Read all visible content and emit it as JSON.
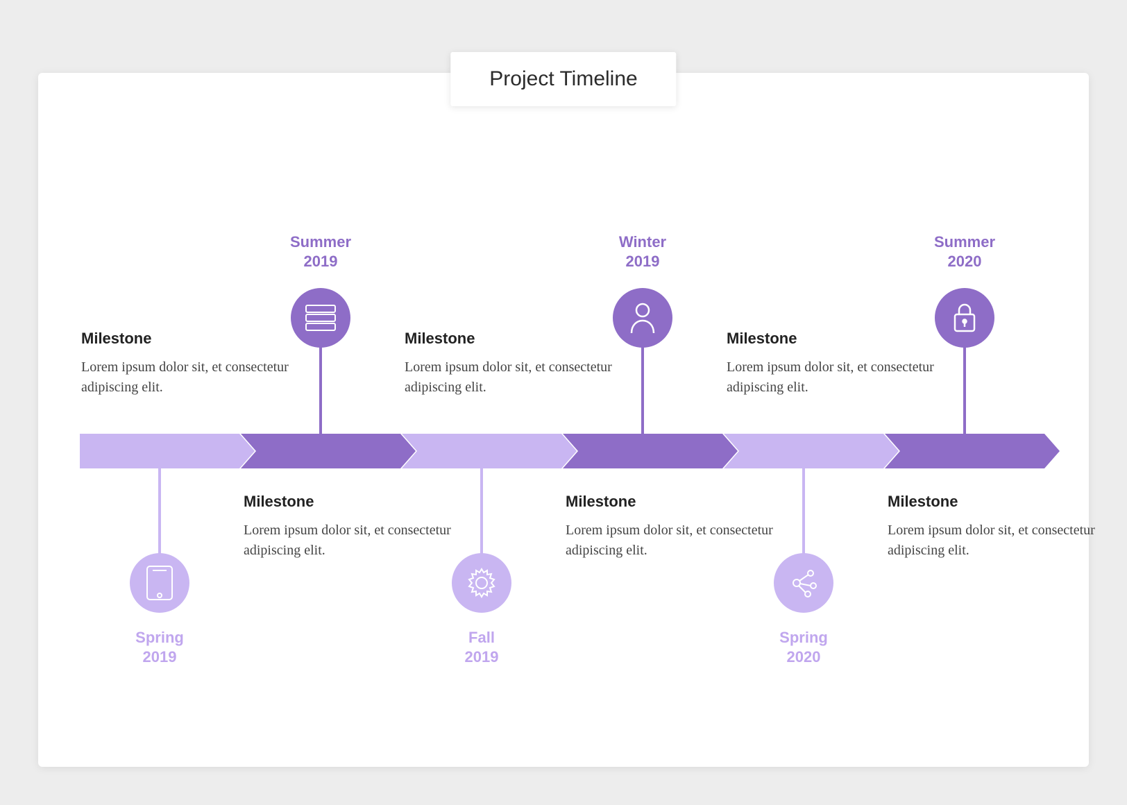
{
  "title": "Project Timeline",
  "colors": {
    "light": "#c9b6f2",
    "dark": "#8e6dc7"
  },
  "milestones": [
    {
      "season": "Spring",
      "year": "2019",
      "heading": "Milestone",
      "body": "Lorem ipsum dolor sit, et consectetur adipiscing elit.",
      "icon": "phone",
      "shade": "light",
      "pos": "below"
    },
    {
      "season": "Summer",
      "year": "2019",
      "heading": "Milestone",
      "body": "Lorem ipsum dolor sit, et consectetur adipiscing elit.",
      "icon": "server",
      "shade": "dark",
      "pos": "above"
    },
    {
      "season": "Fall",
      "year": "2019",
      "heading": "Milestone",
      "body": "Lorem ipsum dolor sit, et consectetur adipiscing elit.",
      "icon": "gear",
      "shade": "light",
      "pos": "below"
    },
    {
      "season": "Winter",
      "year": "2019",
      "heading": "Milestone",
      "body": "Lorem ipsum dolor sit, et consectetur adipiscing elit.",
      "icon": "person",
      "shade": "dark",
      "pos": "above"
    },
    {
      "season": "Spring",
      "year": "2020",
      "heading": "Milestone",
      "body": "Lorem ipsum dolor sit, et consectetur adipiscing elit.",
      "icon": "network",
      "shade": "light",
      "pos": "below"
    },
    {
      "season": "Summer",
      "year": "2020",
      "heading": "Milestone",
      "body": "Lorem ipsum dolor sit, et consectetur adipiscing elit.",
      "icon": "lock",
      "shade": "dark",
      "pos": "above"
    }
  ]
}
